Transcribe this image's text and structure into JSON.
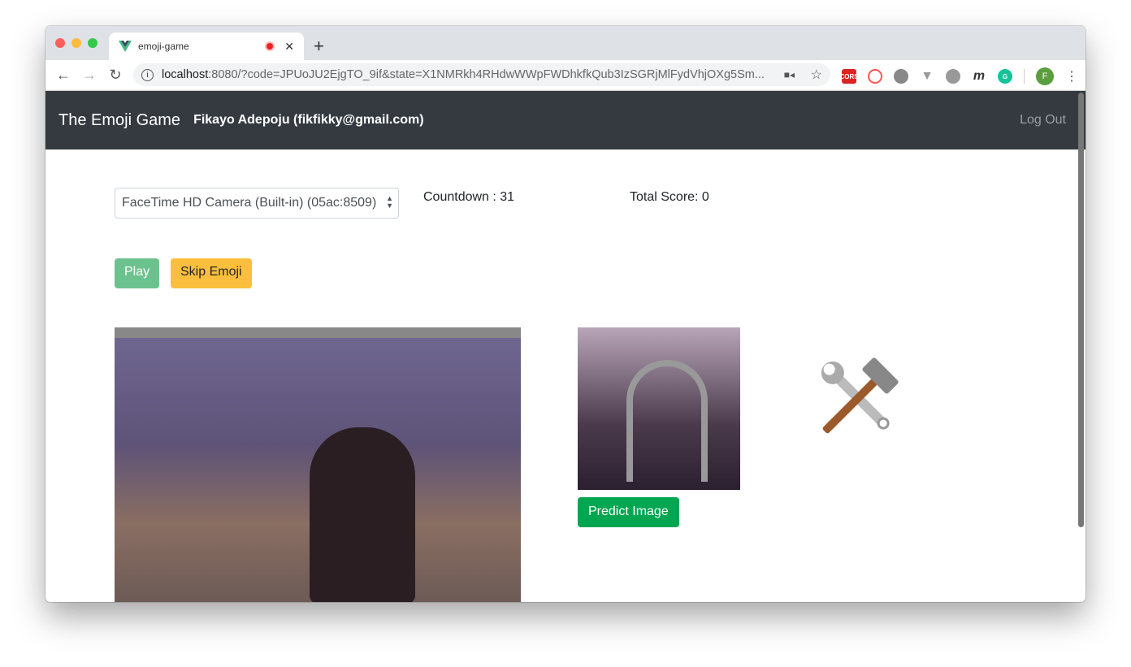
{
  "browser": {
    "tab_title": "emoji-game",
    "url_host": "localhost",
    "url_rest": ":8080/?code=JPUoJU2EjgTO_9if&state=X1NMRkh4RHdwWWpFWDhkfkQub3IzSGRjMlFydVhjOXg5Sm...",
    "profile_initial": "F",
    "ext_cors": "CORS"
  },
  "navbar": {
    "brand": "The Emoji Game",
    "user": "Fikayo Adepoju (fikfikky@gmail.com)",
    "logout": "Log Out"
  },
  "controls": {
    "camera_select": "FaceTime HD Camera (Built-in) (05ac:8509)",
    "countdown": "Countdown : 31",
    "total_score": "Total Score: 0",
    "play": "Play",
    "skip": "Skip Emoji",
    "predict": "Predict Image"
  },
  "colors": {
    "navbar": "#343a40",
    "play": "#6cc28f",
    "skip": "#fbbf3d",
    "predict": "#00a650"
  },
  "target_emoji": "hammer-and-wrench"
}
